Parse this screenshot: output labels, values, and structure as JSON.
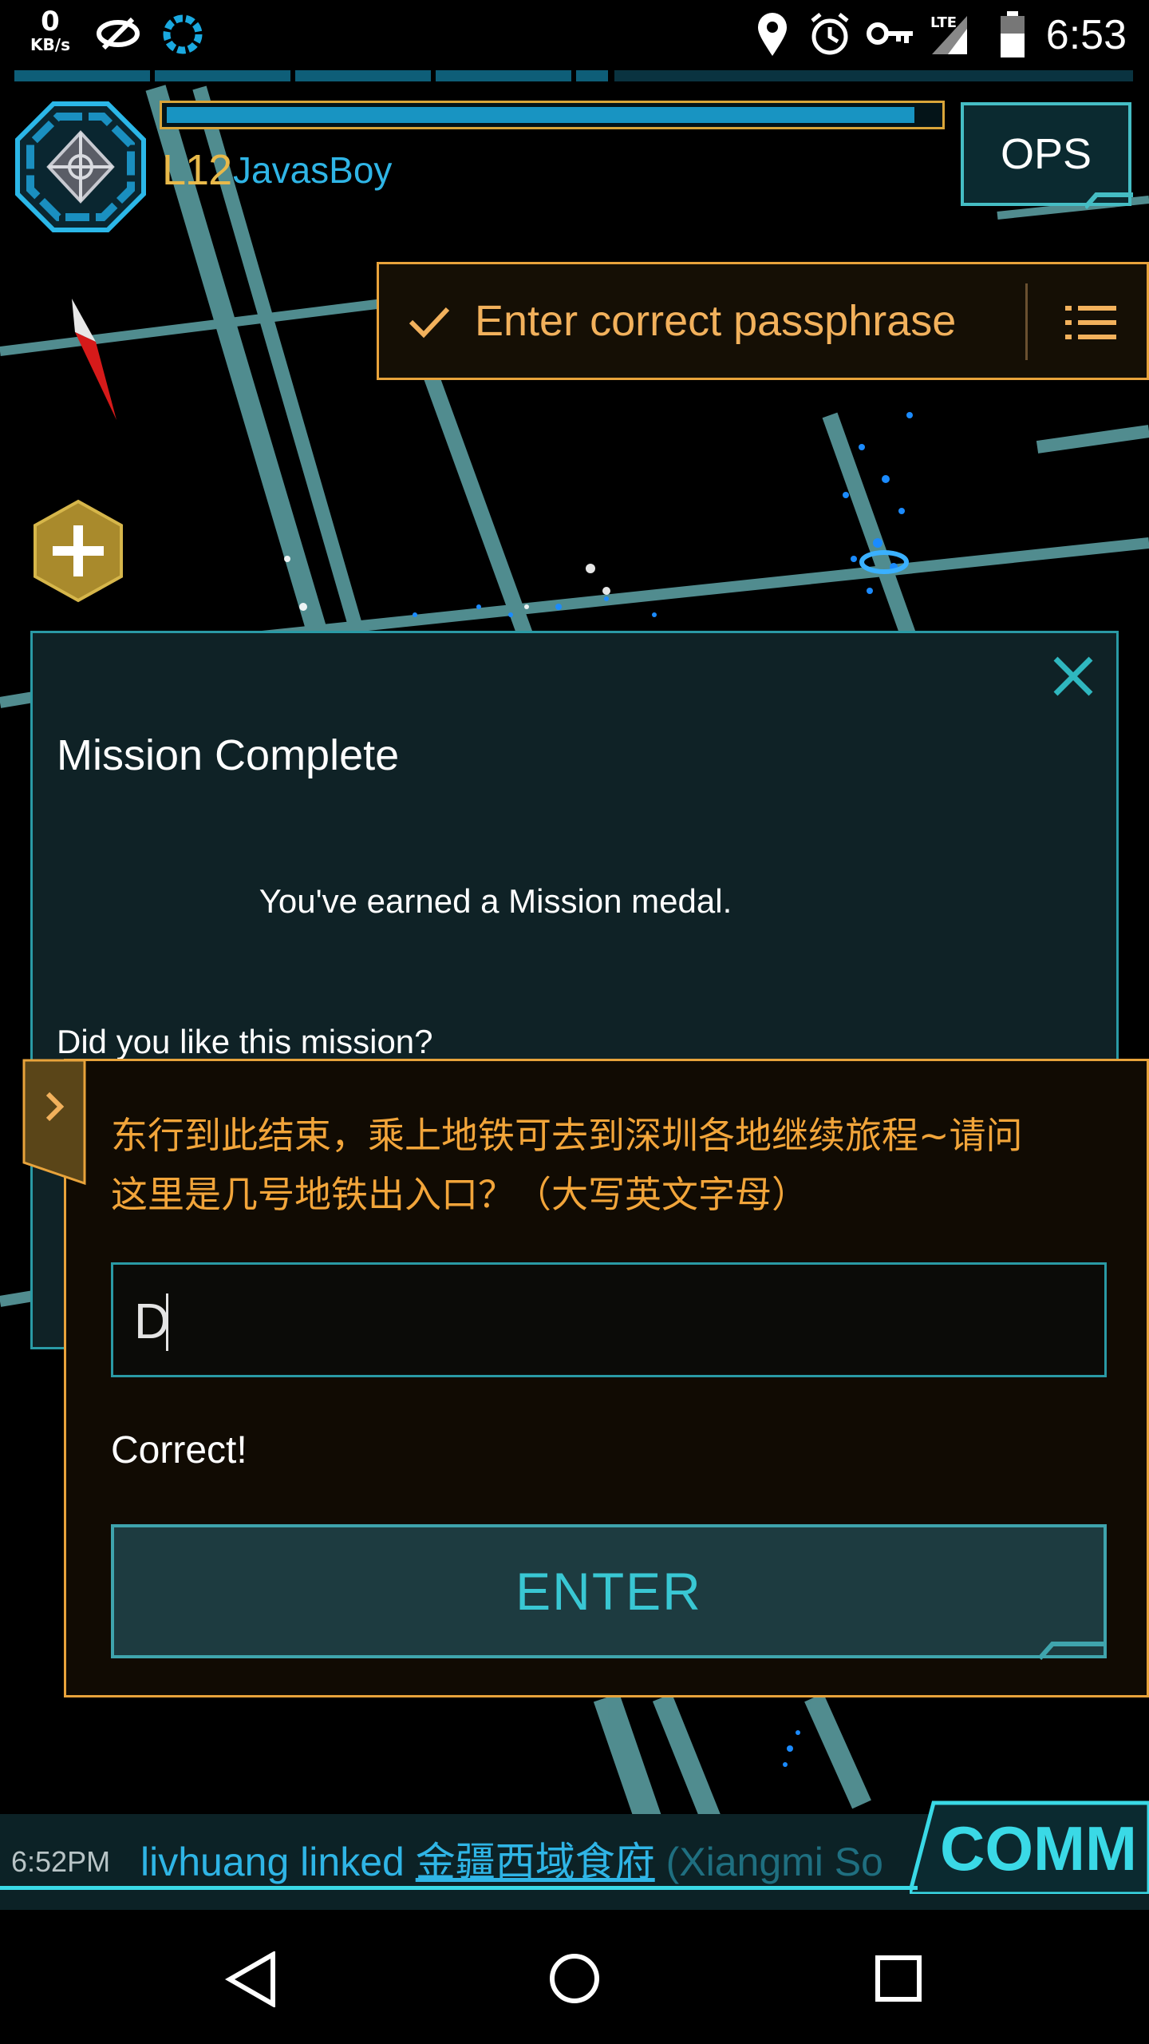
{
  "status_bar": {
    "net_speed_value": "0",
    "net_speed_unit": "KB/s",
    "network_label": "LTE",
    "time": "6:53"
  },
  "player": {
    "level": "L12",
    "name": "JavasBoy",
    "xp_progress": 0.97
  },
  "ops_button": {
    "label": "OPS"
  },
  "objective": {
    "text": "Enter correct passphrase"
  },
  "mission_dialog": {
    "title": "Mission Complete",
    "message": "You've earned a Mission medal.",
    "question": "Did you like this mission?"
  },
  "passphrase_panel": {
    "question_line1": "东行到此结束，乘上地铁可去到深圳各地继续旅程~请问",
    "question_line2": "这里是几号地铁出入口？（大写英文字母）",
    "answer_value": "D",
    "result_text": "Correct!",
    "enter_label": "ENTER"
  },
  "comm": {
    "time": "6:52PM",
    "user": "livhuang",
    "verb": "linked",
    "portal": "金疆西域食府",
    "rest": " (Xiangmi So",
    "button_label": "COMM"
  },
  "colors": {
    "accent_cyan": "#2fb5e6",
    "accent_orange": "#e8a33b",
    "teal_border": "#2a9aa5"
  },
  "icons": {
    "objective_check": "check-icon",
    "objective_menu": "list-icon",
    "close": "close-icon",
    "collapse": "chevron-right-icon",
    "add": "plus-hex-icon",
    "compass": "compass-icon"
  }
}
